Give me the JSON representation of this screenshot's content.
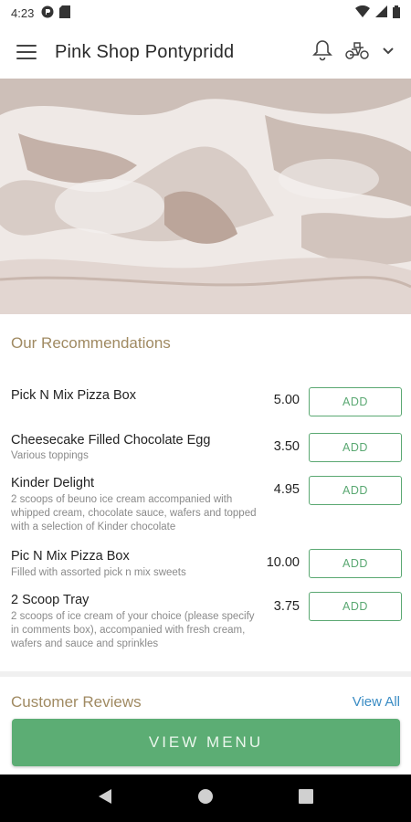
{
  "status_bar": {
    "time": "4:23"
  },
  "app_bar": {
    "title": "Pink Shop Pontypridd"
  },
  "recommendations": {
    "title": "Our Recommendations",
    "items": [
      {
        "name": "Pick N Mix Pizza Box",
        "description": "",
        "price": "5.00",
        "add_label": "ADD"
      },
      {
        "name": "Cheesecake Filled Chocolate Egg",
        "description": "Various toppings",
        "price": "3.50",
        "add_label": "ADD"
      },
      {
        "name": "Kinder Delight",
        "description": "2 scoops of beuno ice cream accompanied with whipped cream, chocolate sauce, wafers and topped with a selection of Kinder chocolate",
        "price": "4.95",
        "add_label": "ADD"
      },
      {
        "name": "Pic N Mix Pizza Box",
        "description": "Filled with assorted pick n mix sweets",
        "price": "10.00",
        "add_label": "ADD"
      },
      {
        "name": "2 Scoop Tray",
        "description": "2 scoops of ice cream of your choice (please specify in comments box), accompanied with fresh cream, wafers and sauce and sprinkles",
        "price": "3.75",
        "add_label": "ADD"
      }
    ]
  },
  "reviews": {
    "title": "Customer Reviews",
    "view_all_label": "View All"
  },
  "cta": {
    "view_menu_label": "VIEW MENU"
  },
  "colors": {
    "accent_green": "#5cad74",
    "section_title": "#a08a62",
    "link_blue": "#3a8cc4"
  }
}
